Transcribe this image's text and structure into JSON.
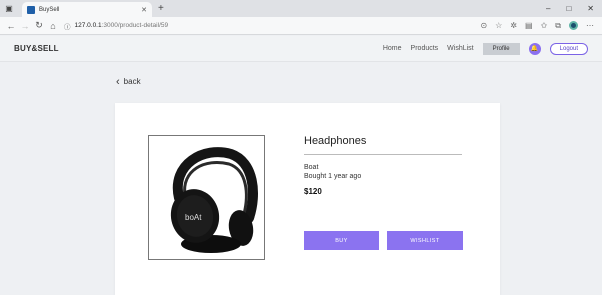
{
  "browser": {
    "tab_title": "BuySell",
    "url_host": "127.0.0.1",
    "url_path": ":3000/product-detail/59"
  },
  "header": {
    "brand": "BUY&SELL",
    "nav": [
      "Home",
      "Products",
      "WishList"
    ],
    "profile_label": "Profile",
    "logout_label": "Logout",
    "accent": "#8b73f0"
  },
  "page": {
    "back_label": "back"
  },
  "product": {
    "name": "Headphones",
    "brand": "Boat",
    "bought": "Bought 1 year ago",
    "price": "$120",
    "image_logo_text": "boAt",
    "buy_label": "BUY",
    "wishlist_label": "WISHLIST"
  }
}
